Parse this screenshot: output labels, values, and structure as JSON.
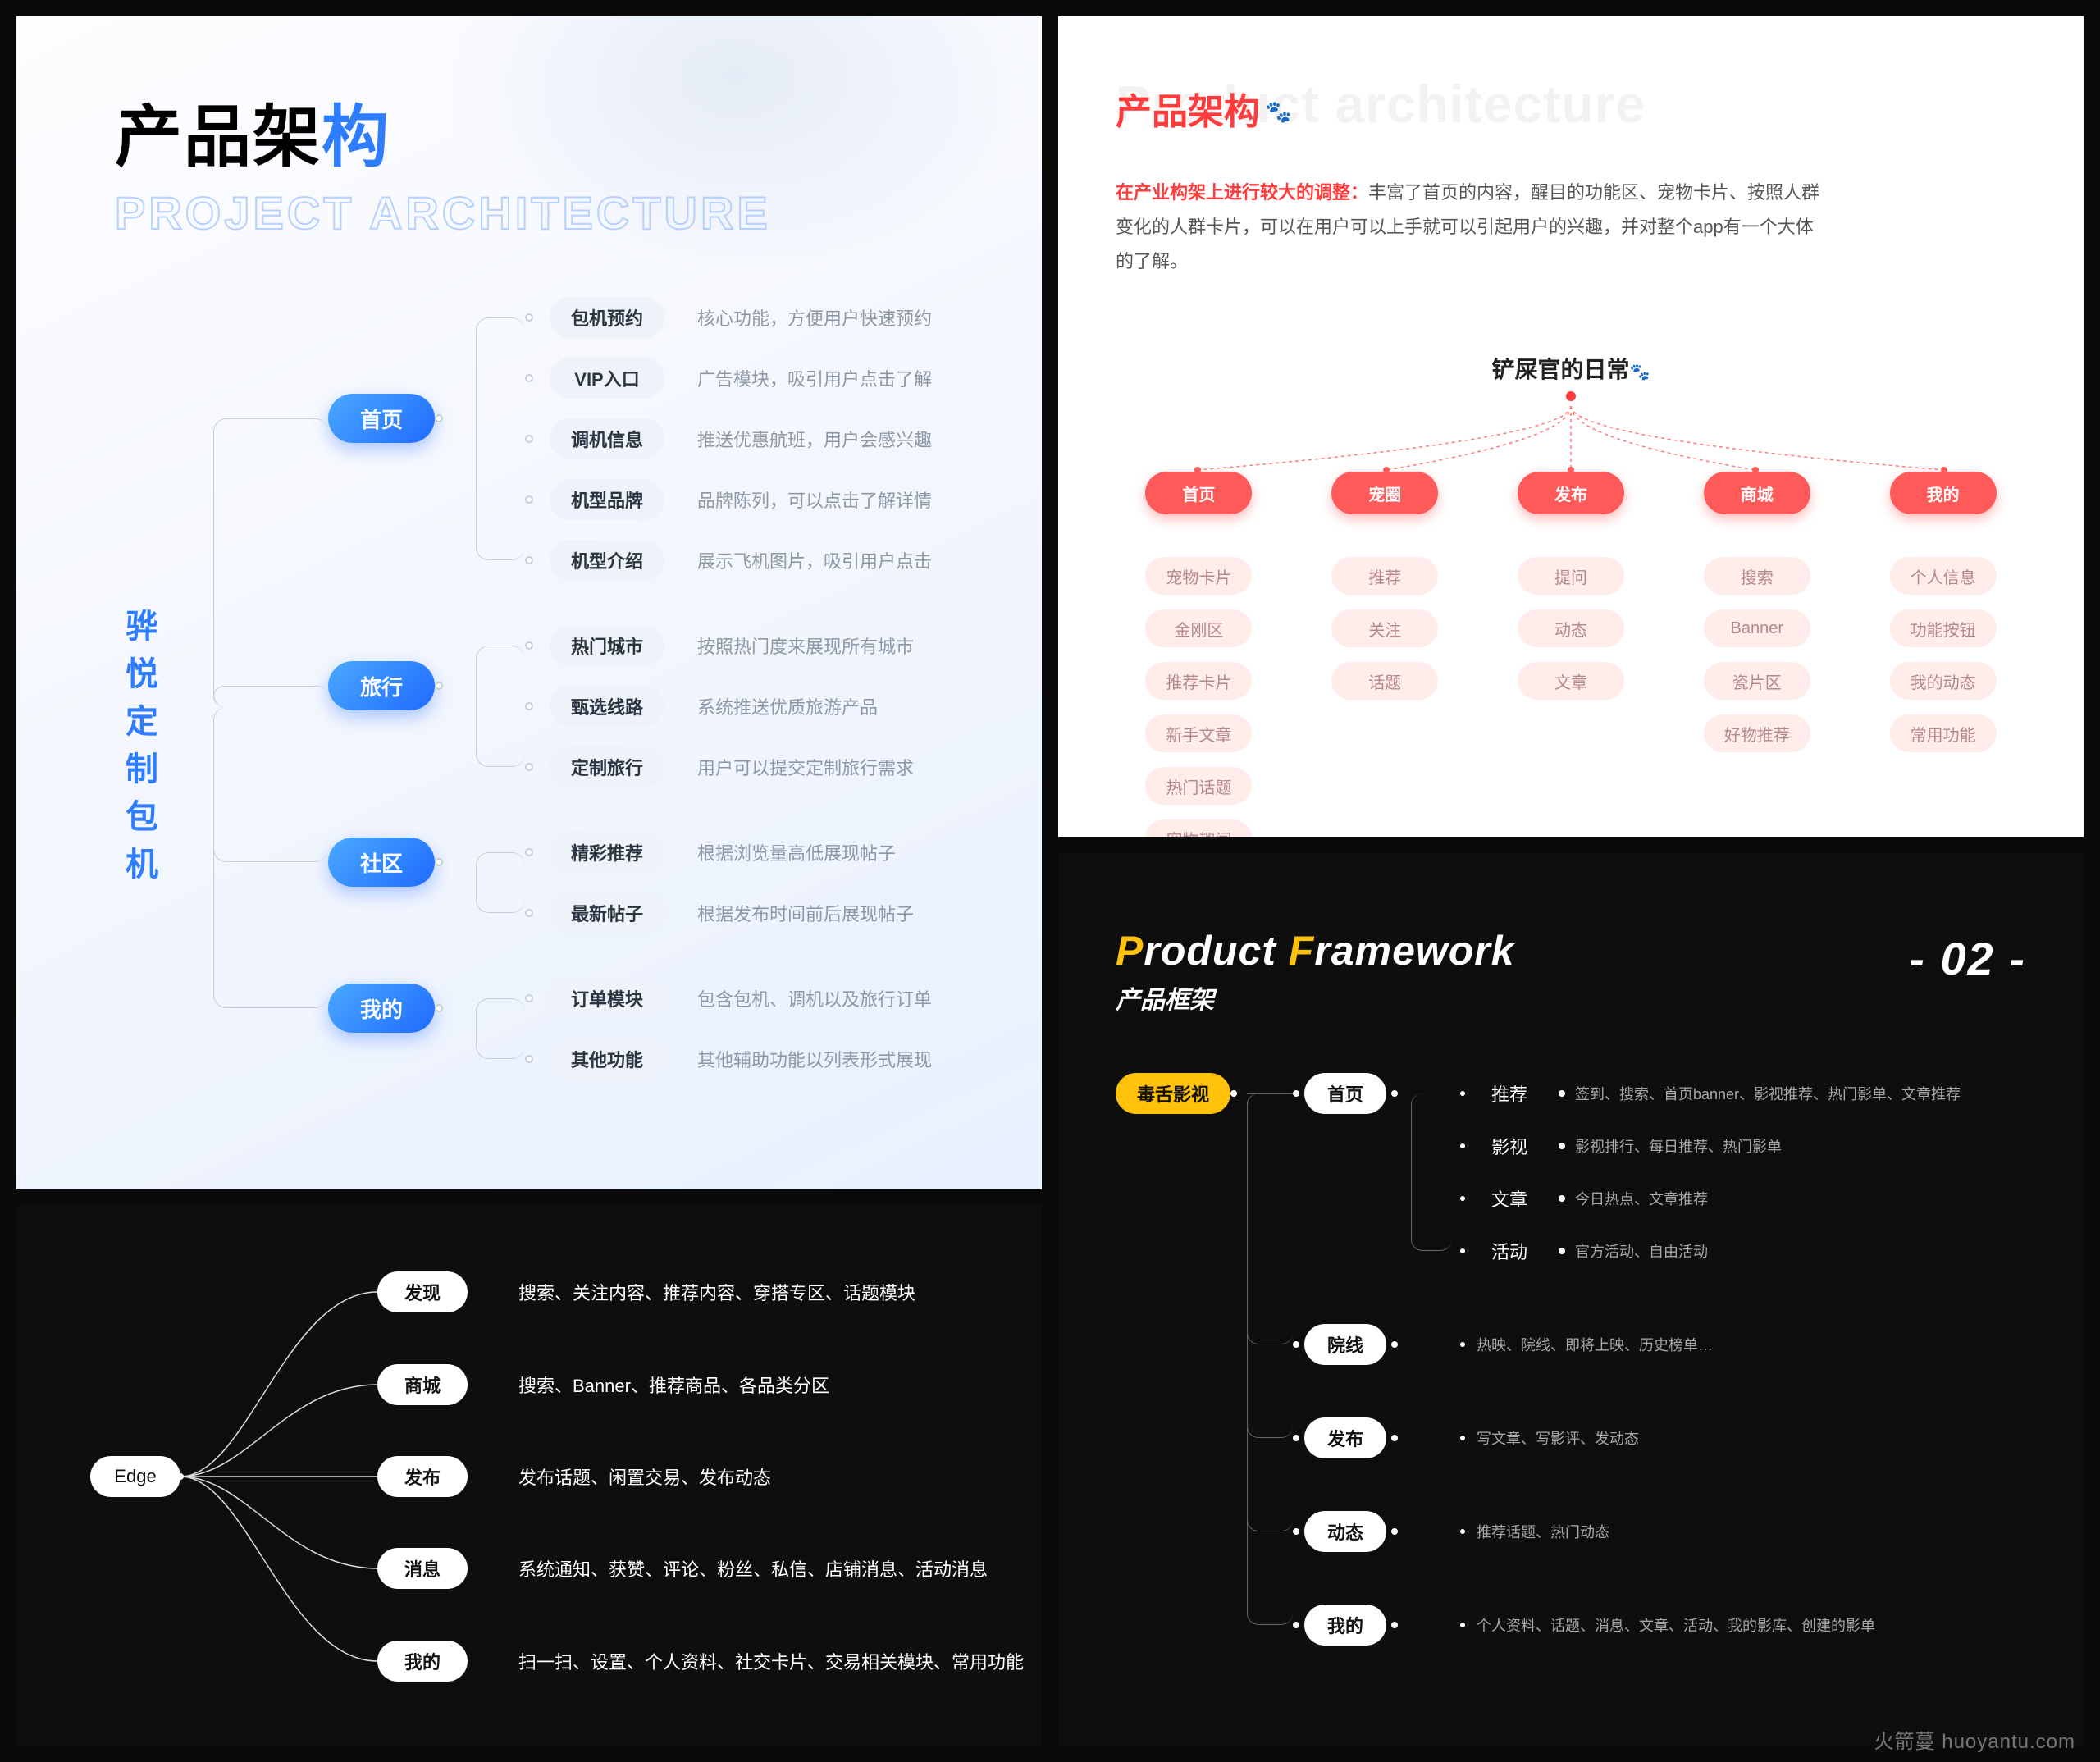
{
  "q1": {
    "title_a": "产品架",
    "title_b": "构",
    "subtitle": "PROJECT ARCHITECTURE",
    "root": "骅悦定制包机",
    "cats": [
      {
        "label": "首页",
        "leaves": [
          {
            "label": "包机预约",
            "desc": "核心功能，方便用户快速预约"
          },
          {
            "label": "VIP入口",
            "desc": "广告模块，吸引用户点击了解"
          },
          {
            "label": "调机信息",
            "desc": "推送优惠航班，用户会感兴趣"
          },
          {
            "label": "机型品牌",
            "desc": "品牌陈列，可以点击了解详情"
          },
          {
            "label": "机型介绍",
            "desc": "展示飞机图片，吸引用户点击"
          }
        ]
      },
      {
        "label": "旅行",
        "leaves": [
          {
            "label": "热门城市",
            "desc": "按照热门度来展现所有城市"
          },
          {
            "label": "甄选线路",
            "desc": "系统推送优质旅游产品"
          },
          {
            "label": "定制旅行",
            "desc": "用户可以提交定制旅行需求"
          }
        ]
      },
      {
        "label": "社区",
        "leaves": [
          {
            "label": "精彩推荐",
            "desc": "根据浏览量高低展现帖子"
          },
          {
            "label": "最新帖子",
            "desc": "根据发布时间前后展现帖子"
          }
        ]
      },
      {
        "label": "我的",
        "leaves": [
          {
            "label": "订单模块",
            "desc": "包含包机、调机以及旅行订单"
          },
          {
            "label": "其他功能",
            "desc": "其他辅助功能以列表形式展现"
          }
        ]
      }
    ]
  },
  "q2": {
    "ghost": "Product architecture",
    "title": "产品架构",
    "para_em": "在产业构架上进行较大的调整：",
    "para_rest": "丰富了首页的内容，醒目的功能区、宠物卡片、按照人群变化的人群卡片，可以在用户可以上手就可以引起用户的兴趣，并对整个app有一个大体的了解。",
    "root": "铲屎官的日常",
    "cols": [
      {
        "head": "首页",
        "subs": [
          "宠物卡片",
          "金刚区",
          "推荐卡片",
          "新手文章",
          "热门话题",
          "宠物趣闻"
        ]
      },
      {
        "head": "宠圈",
        "subs": [
          "推荐",
          "关注",
          "话题"
        ]
      },
      {
        "head": "发布",
        "subs": [
          "提问",
          "动态",
          "文章"
        ]
      },
      {
        "head": "商城",
        "subs": [
          "搜索",
          "Banner",
          "瓷片区",
          "好物推荐"
        ]
      },
      {
        "head": "我的",
        "subs": [
          "个人信息",
          "功能按钮",
          "我的动态",
          "常用功能"
        ]
      }
    ]
  },
  "q3": {
    "root": "Edge",
    "cats": [
      {
        "label": "发现",
        "desc": "搜索、关注内容、推荐内容、穿搭专区、话题模块"
      },
      {
        "label": "商城",
        "desc": "搜索、Banner、推荐商品、各品类分区"
      },
      {
        "label": "发布",
        "desc": "发布话题、闲置交易、发布动态"
      },
      {
        "label": "消息",
        "desc": "系统通知、获赞、评论、粉丝、私信、店铺消息、活动消息"
      },
      {
        "label": "我的",
        "desc": "扫一扫、设置、个人资料、社交卡片、交易相关模块、常用功能"
      }
    ]
  },
  "q4": {
    "title_pre1": "P",
    "title_mid1": "roduct ",
    "title_pre2": "F",
    "title_mid2": "ramework",
    "subtitle": "产品框架",
    "num": "- 02 -",
    "root": "毒舌影视",
    "cats": [
      {
        "label": "首页",
        "leaves": [
          {
            "label": "推荐",
            "desc": "签到、搜索、首页banner、影视推荐、热门影单、文章推荐"
          },
          {
            "label": "影视",
            "desc": "影视排行、每日推荐、热门影单"
          },
          {
            "label": "文章",
            "desc": "今日热点、文章推荐"
          },
          {
            "label": "活动",
            "desc": "官方活动、自由活动"
          }
        ]
      },
      {
        "label": "院线",
        "leaves": [
          {
            "label": "",
            "desc": "热映、院线、即将上映、历史榜单…"
          }
        ]
      },
      {
        "label": "发布",
        "leaves": [
          {
            "label": "",
            "desc": "写文章、写影评、发动态"
          }
        ]
      },
      {
        "label": "动态",
        "leaves": [
          {
            "label": "",
            "desc": "推荐话题、热门动态"
          }
        ]
      },
      {
        "label": "我的",
        "leaves": [
          {
            "label": "",
            "desc": "个人资料、话题、消息、文章、活动、我的影库、创建的影单"
          }
        ]
      }
    ]
  },
  "watermark": "火箭蔓 huoyantu.com"
}
